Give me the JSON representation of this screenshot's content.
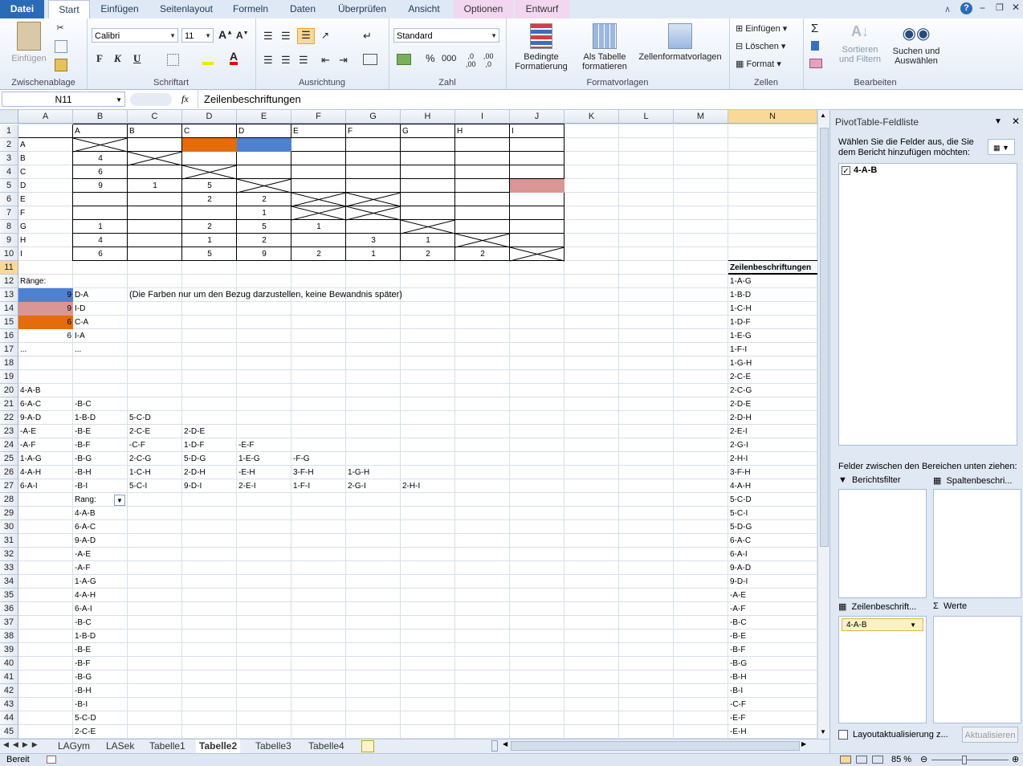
{
  "tabs": {
    "file": "Datei",
    "start": "Start",
    "insert": "Einfügen",
    "layout": "Seitenlayout",
    "formulas": "Formeln",
    "data": "Daten",
    "review": "Überprüfen",
    "view": "Ansicht",
    "options": "Optionen",
    "design": "Entwurf"
  },
  "ribbon": {
    "paste": "Einfügen",
    "clipboard": "Zwischenablage",
    "font_name": "Calibri",
    "font_size": "11",
    "font": "Schriftart",
    "alignment": "Ausrichtung",
    "number_format": "Standard",
    "number": "Zahl",
    "cond_format_1": "Bedingte",
    "cond_format_2": "Formatierung",
    "as_table_1": "Als Tabelle",
    "as_table_2": "formatieren",
    "cell_styles": "Zellenformatvorlagen",
    "styles": "Formatvorlagen",
    "insert_cells": "Einfügen",
    "delete_cells": "Löschen",
    "format_cells": "Format",
    "cells": "Zellen",
    "sort_1": "Sortieren",
    "sort_2": "und Filtern",
    "find_1": "Suchen und",
    "find_2": "Auswählen",
    "editing": "Bearbeiten",
    "bold": "F",
    "italic": "K",
    "underline": "U"
  },
  "formula_bar": {
    "name_box": "N11",
    "fx": "fx",
    "formula": "Zeilenbeschriftungen"
  },
  "columns": [
    "A",
    "B",
    "C",
    "D",
    "E",
    "F",
    "G",
    "H",
    "I",
    "J",
    "K",
    "L",
    "M",
    "N"
  ],
  "colors": {
    "blue": "#4f81d1",
    "orange": "#e46c0a",
    "pink": "#d99694",
    "selection": "#f9d998"
  },
  "sheet_tabs": [
    "LAGym",
    "LASek",
    "Tabelle1",
    "Tabelle2",
    "Tabelle3",
    "Tabelle4"
  ],
  "active_sheet": "Tabelle2",
  "status": {
    "ready": "Bereit",
    "zoom": "85 %"
  },
  "pivot": {
    "title": "PivotTable-Feldliste",
    "instruction": "Wählen Sie die Felder aus, die Sie dem Bericht hinzufügen möchten:",
    "field": "4-A-B",
    "drag_text": "Felder zwischen den Bereichen unten ziehen:",
    "report_filter": "Berichtsfilter",
    "column_labels": "Spaltenbeschri...",
    "row_labels": "Zeilenbeschrift...",
    "values": "Werte",
    "row_field": "4-A-B",
    "defer": "Layoutaktualisierung z...",
    "update": "Aktualisieren"
  },
  "pivot_header": "Zeilenbeschriftungen",
  "pivot_items": [
    "1-A-G",
    "1-B-D",
    "1-C-H",
    "1-D-F",
    "1-E-G",
    "1-F-I",
    "1-G-H",
    "2-C-E",
    "2-C-G",
    "2-D-E",
    "2-D-H",
    "2-E-I",
    "2-G-I",
    "2-H-I",
    "3-F-H",
    "4-A-H",
    "5-C-D",
    "5-C-I",
    "5-D-G",
    "6-A-C",
    "6-A-I",
    "9-A-D",
    "9-D-I",
    "-A-E",
    "-A-F",
    "-B-C",
    "-B-E",
    "-B-F",
    "-B-G",
    "-B-H",
    "-B-I",
    "-C-F",
    "-E-F",
    "-E-H"
  ],
  "cells": [
    {
      "r": 1,
      "c": "B",
      "v": "A"
    },
    {
      "r": 1,
      "c": "C",
      "v": "B"
    },
    {
      "r": 1,
      "c": "D",
      "v": "C"
    },
    {
      "r": 1,
      "c": "E",
      "v": "D"
    },
    {
      "r": 1,
      "c": "F",
      "v": "E"
    },
    {
      "r": 1,
      "c": "G",
      "v": "F"
    },
    {
      "r": 1,
      "c": "H",
      "v": "G"
    },
    {
      "r": 1,
      "c": "I",
      "v": "H"
    },
    {
      "r": 1,
      "c": "J",
      "v": "I"
    },
    {
      "r": 2,
      "c": "A",
      "v": "A"
    },
    {
      "r": 3,
      "c": "A",
      "v": "B"
    },
    {
      "r": 4,
      "c": "A",
      "v": "C"
    },
    {
      "r": 5,
      "c": "A",
      "v": "D"
    },
    {
      "r": 6,
      "c": "A",
      "v": "E"
    },
    {
      "r": 7,
      "c": "A",
      "v": "F"
    },
    {
      "r": 8,
      "c": "A",
      "v": "G"
    },
    {
      "r": 9,
      "c": "A",
      "v": "H"
    },
    {
      "r": 10,
      "c": "A",
      "v": "I"
    },
    {
      "r": 3,
      "c": "B",
      "v": "4",
      "a": "ctr"
    },
    {
      "r": 4,
      "c": "B",
      "v": "6",
      "a": "ctr"
    },
    {
      "r": 5,
      "c": "B",
      "v": "9",
      "a": "ctr"
    },
    {
      "r": 5,
      "c": "C",
      "v": "1",
      "a": "ctr"
    },
    {
      "r": 5,
      "c": "D",
      "v": "5",
      "a": "ctr"
    },
    {
      "r": 6,
      "c": "D",
      "v": "2",
      "a": "ctr"
    },
    {
      "r": 6,
      "c": "E",
      "v": "2",
      "a": "ctr"
    },
    {
      "r": 7,
      "c": "E",
      "v": "1",
      "a": "ctr"
    },
    {
      "r": 8,
      "c": "B",
      "v": "1",
      "a": "ctr"
    },
    {
      "r": 8,
      "c": "D",
      "v": "2",
      "a": "ctr"
    },
    {
      "r": 8,
      "c": "E",
      "v": "5",
      "a": "ctr"
    },
    {
      "r": 8,
      "c": "F",
      "v": "1",
      "a": "ctr"
    },
    {
      "r": 9,
      "c": "B",
      "v": "4",
      "a": "ctr"
    },
    {
      "r": 9,
      "c": "D",
      "v": "1",
      "a": "ctr"
    },
    {
      "r": 9,
      "c": "E",
      "v": "2",
      "a": "ctr"
    },
    {
      "r": 9,
      "c": "G",
      "v": "3",
      "a": "ctr"
    },
    {
      "r": 9,
      "c": "H",
      "v": "1",
      "a": "ctr"
    },
    {
      "r": 10,
      "c": "B",
      "v": "6",
      "a": "ctr"
    },
    {
      "r": 10,
      "c": "D",
      "v": "5",
      "a": "ctr"
    },
    {
      "r": 10,
      "c": "E",
      "v": "9",
      "a": "ctr"
    },
    {
      "r": 10,
      "c": "F",
      "v": "2",
      "a": "ctr"
    },
    {
      "r": 10,
      "c": "G",
      "v": "1",
      "a": "ctr"
    },
    {
      "r": 10,
      "c": "H",
      "v": "2",
      "a": "ctr"
    },
    {
      "r": 10,
      "c": "I",
      "v": "2",
      "a": "ctr"
    },
    {
      "r": 12,
      "c": "A",
      "v": "Ränge:"
    },
    {
      "r": 13,
      "c": "A",
      "v": "9",
      "a": "num"
    },
    {
      "r": 13,
      "c": "B",
      "v": "D-A"
    },
    {
      "r": 13,
      "c": "C",
      "v": "(Die Farben nur um den Bezug darzustellen, keine Bewandnis später)",
      "big": true
    },
    {
      "r": 14,
      "c": "A",
      "v": "9",
      "a": "num"
    },
    {
      "r": 14,
      "c": "B",
      "v": "I-D"
    },
    {
      "r": 15,
      "c": "A",
      "v": "6",
      "a": "num"
    },
    {
      "r": 15,
      "c": "B",
      "v": "C-A"
    },
    {
      "r": 16,
      "c": "A",
      "v": "6",
      "a": "num"
    },
    {
      "r": 16,
      "c": "B",
      "v": "I-A"
    },
    {
      "r": 17,
      "c": "A",
      "v": "..."
    },
    {
      "r": 17,
      "c": "B",
      "v": "..."
    },
    {
      "r": 20,
      "c": "A",
      "v": "4-A-B"
    },
    {
      "r": 21,
      "c": "A",
      "v": "6-A-C"
    },
    {
      "r": 21,
      "c": "B",
      "v": "-B-C"
    },
    {
      "r": 22,
      "c": "A",
      "v": "9-A-D"
    },
    {
      "r": 22,
      "c": "B",
      "v": "1-B-D"
    },
    {
      "r": 22,
      "c": "C",
      "v": "5-C-D"
    },
    {
      "r": 23,
      "c": "A",
      "v": "-A-E"
    },
    {
      "r": 23,
      "c": "B",
      "v": "-B-E"
    },
    {
      "r": 23,
      "c": "C",
      "v": "2-C-E"
    },
    {
      "r": 23,
      "c": "D",
      "v": "2-D-E"
    },
    {
      "r": 24,
      "c": "A",
      "v": "-A-F"
    },
    {
      "r": 24,
      "c": "B",
      "v": "-B-F"
    },
    {
      "r": 24,
      "c": "C",
      "v": "-C-F"
    },
    {
      "r": 24,
      "c": "D",
      "v": "1-D-F"
    },
    {
      "r": 24,
      "c": "E",
      "v": "-E-F"
    },
    {
      "r": 25,
      "c": "A",
      "v": "1-A-G"
    },
    {
      "r": 25,
      "c": "B",
      "v": "-B-G"
    },
    {
      "r": 25,
      "c": "C",
      "v": "2-C-G"
    },
    {
      "r": 25,
      "c": "D",
      "v": "5-D-G"
    },
    {
      "r": 25,
      "c": "E",
      "v": "1-E-G"
    },
    {
      "r": 25,
      "c": "F",
      "v": "-F-G"
    },
    {
      "r": 26,
      "c": "A",
      "v": "4-A-H"
    },
    {
      "r": 26,
      "c": "B",
      "v": "-B-H"
    },
    {
      "r": 26,
      "c": "C",
      "v": "1-C-H"
    },
    {
      "r": 26,
      "c": "D",
      "v": "2-D-H"
    },
    {
      "r": 26,
      "c": "E",
      "v": "-E-H"
    },
    {
      "r": 26,
      "c": "F",
      "v": "3-F-H"
    },
    {
      "r": 26,
      "c": "G",
      "v": "1-G-H"
    },
    {
      "r": 27,
      "c": "A",
      "v": "6-A-I"
    },
    {
      "r": 27,
      "c": "B",
      "v": "-B-I"
    },
    {
      "r": 27,
      "c": "C",
      "v": "5-C-I"
    },
    {
      "r": 27,
      "c": "D",
      "v": "9-D-I"
    },
    {
      "r": 27,
      "c": "E",
      "v": "2-E-I"
    },
    {
      "r": 27,
      "c": "F",
      "v": "1-F-I"
    },
    {
      "r": 27,
      "c": "G",
      "v": "2-G-I"
    },
    {
      "r": 27,
      "c": "H",
      "v": "2-H-I"
    },
    {
      "r": 28,
      "c": "B",
      "v": "Rang:"
    },
    {
      "r": 29,
      "c": "B",
      "v": "4-A-B"
    },
    {
      "r": 30,
      "c": "B",
      "v": "6-A-C"
    },
    {
      "r": 31,
      "c": "B",
      "v": "9-A-D"
    },
    {
      "r": 32,
      "c": "B",
      "v": "-A-E"
    },
    {
      "r": 33,
      "c": "B",
      "v": "-A-F"
    },
    {
      "r": 34,
      "c": "B",
      "v": "1-A-G"
    },
    {
      "r": 35,
      "c": "B",
      "v": "4-A-H"
    },
    {
      "r": 36,
      "c": "B",
      "v": "6-A-I"
    },
    {
      "r": 37,
      "c": "B",
      "v": "-B-C"
    },
    {
      "r": 38,
      "c": "B",
      "v": "1-B-D"
    },
    {
      "r": 39,
      "c": "B",
      "v": "-B-E"
    },
    {
      "r": 40,
      "c": "B",
      "v": "-B-F"
    },
    {
      "r": 41,
      "c": "B",
      "v": "-B-G"
    },
    {
      "r": 42,
      "c": "B",
      "v": "-B-H"
    },
    {
      "r": 43,
      "c": "B",
      "v": "-B-I"
    },
    {
      "r": 44,
      "c": "B",
      "v": "5-C-D"
    },
    {
      "r": 45,
      "c": "B",
      "v": "2-C-E"
    }
  ],
  "fills": [
    {
      "r": 2,
      "c": "D",
      "color": "orange"
    },
    {
      "r": 2,
      "c": "E",
      "color": "blue"
    },
    {
      "r": 5,
      "c": "J",
      "color": "pink"
    },
    {
      "r": 13,
      "c": "A",
      "color": "blue"
    },
    {
      "r": 14,
      "c": "A",
      "color": "pink"
    },
    {
      "r": 15,
      "c": "A",
      "color": "orange"
    }
  ],
  "crosses": [
    {
      "r": 2,
      "c": "B"
    },
    {
      "r": 3,
      "c": "C"
    },
    {
      "r": 4,
      "c": "D"
    },
    {
      "r": 5,
      "c": "E"
    },
    {
      "r": 6,
      "c": "F"
    },
    {
      "r": 6,
      "c": "G"
    },
    {
      "r": 7,
      "c": "F"
    },
    {
      "r": 7,
      "c": "G"
    },
    {
      "r": 8,
      "c": "H"
    },
    {
      "r": 9,
      "c": "I"
    },
    {
      "r": 10,
      "c": "J"
    }
  ]
}
